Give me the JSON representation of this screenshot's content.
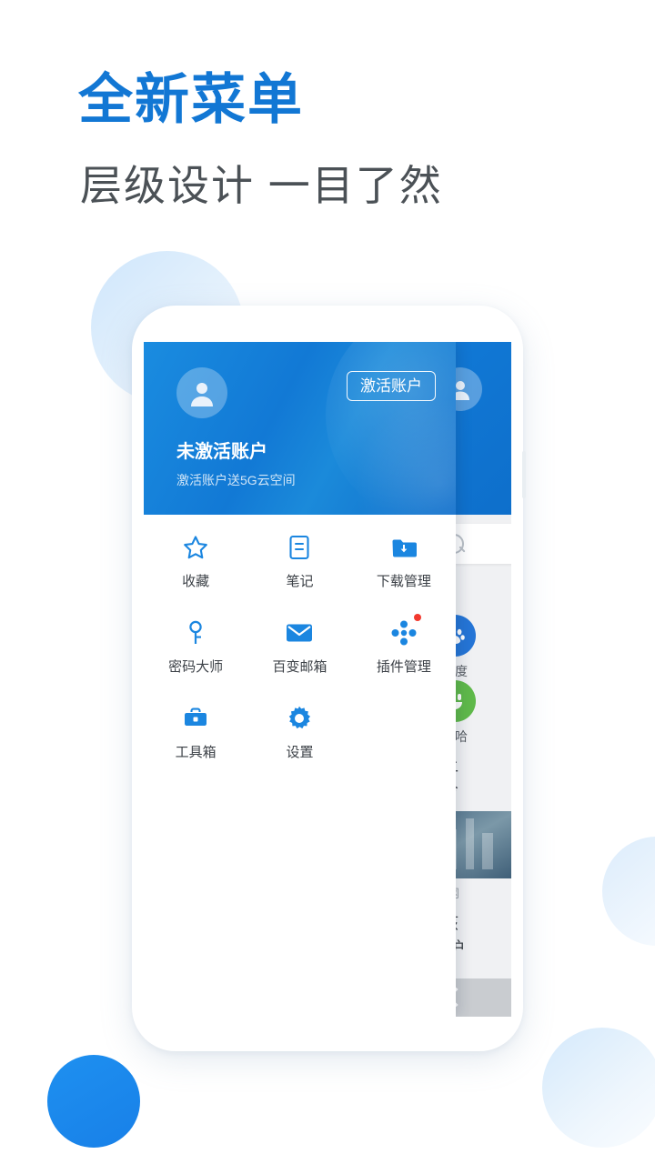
{
  "promo": {
    "headline": "全新菜单",
    "subhead": "层级设计 一目了然",
    "headline_color": "#1277d4",
    "subhead_color": "#4b5156"
  },
  "phone": {
    "menu_panel": {
      "header": {
        "avatar_icon": "user-avatar-icon",
        "activate_button": "激活账户",
        "account_name": "未激活账户",
        "account_subtitle": "激活账户送5G云空间",
        "gradient_start": "#1a8ce0",
        "gradient_end": "#0f6ecb"
      },
      "grid": [
        {
          "icon": "star-icon",
          "label": "收藏",
          "badge": false
        },
        {
          "icon": "note-icon",
          "label": "笔记",
          "badge": false
        },
        {
          "icon": "download-folder-icon",
          "label": "下载管理",
          "badge": false
        },
        {
          "icon": "key-icon",
          "label": "密码大师",
          "badge": false
        },
        {
          "icon": "mail-icon",
          "label": "百变邮箱",
          "badge": false
        },
        {
          "icon": "plugin-icon",
          "label": "插件管理",
          "badge": true
        },
        {
          "icon": "toolbox-icon",
          "label": "工具箱",
          "badge": false
        },
        {
          "icon": "gear-icon",
          "label": "设置",
          "badge": false
        }
      ],
      "accent_color": "#1b86e0"
    },
    "background_panel": {
      "avatar_icon": "user-avatar-icon",
      "search_placeholder": "",
      "search_icon": "search-icon",
      "apps": [
        {
          "icon": "paw-icon",
          "label": "百度",
          "color": "#2575d6"
        },
        {
          "icon": "smile-icon",
          "label": "哈哈",
          "color": "#5fb94a"
        }
      ],
      "news": [
        {
          "text": "曾让\n如今",
          "source": "北青网",
          "has_thumb": true
        },
        {
          "text": "女孩\n助“护",
          "source": "",
          "has_thumb": false
        }
      ],
      "back_icon": "chevron-left-icon"
    }
  }
}
